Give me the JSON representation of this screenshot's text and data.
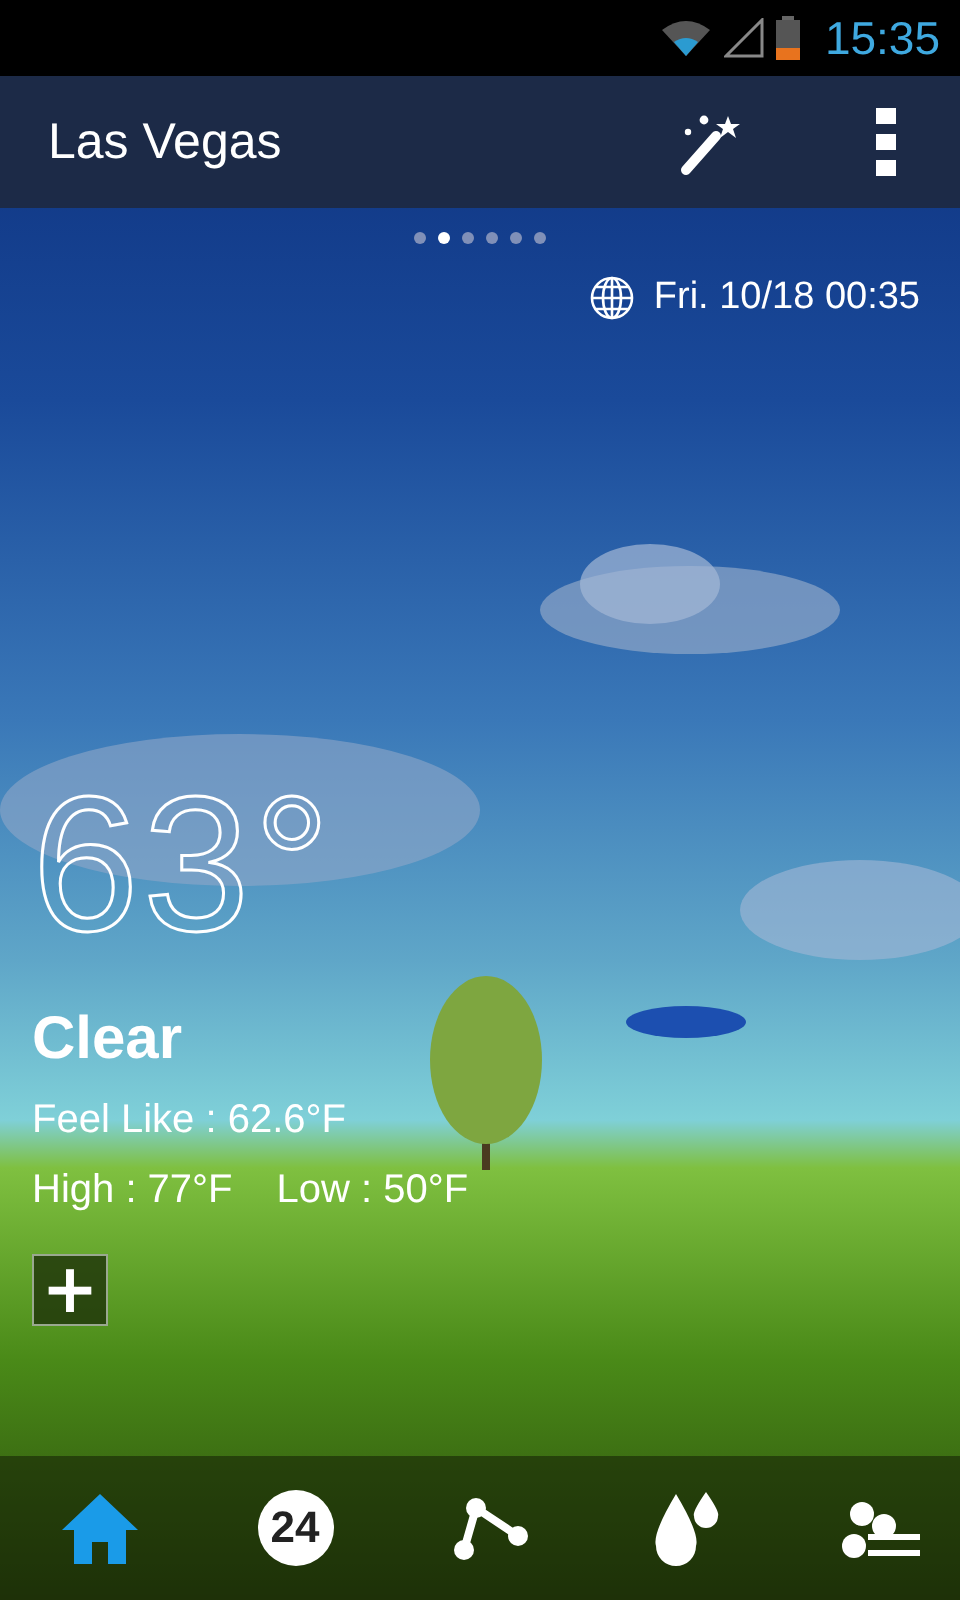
{
  "status_bar": {
    "time": "15:35"
  },
  "app_bar": {
    "title": "Las Vegas"
  },
  "pages": [
    {
      "selected": false
    },
    {
      "selected": true
    },
    {
      "selected": false
    },
    {
      "selected": false
    },
    {
      "selected": false
    },
    {
      "selected": false
    }
  ],
  "date_time": "Fri. 10/18 00:35",
  "weather": {
    "temperature": "63°",
    "condition": "Clear",
    "feel_like": "Feel Like : 62.6°F",
    "high": "High : 77°F",
    "low": "Low : 50°F"
  },
  "add_button": "+",
  "tabs": [
    {
      "kind": "home",
      "selected": true
    },
    {
      "kind": "hourly",
      "label": "24",
      "selected": false
    },
    {
      "kind": "share",
      "selected": false
    },
    {
      "kind": "humidity",
      "selected": false
    },
    {
      "kind": "wind",
      "selected": false
    }
  ]
}
